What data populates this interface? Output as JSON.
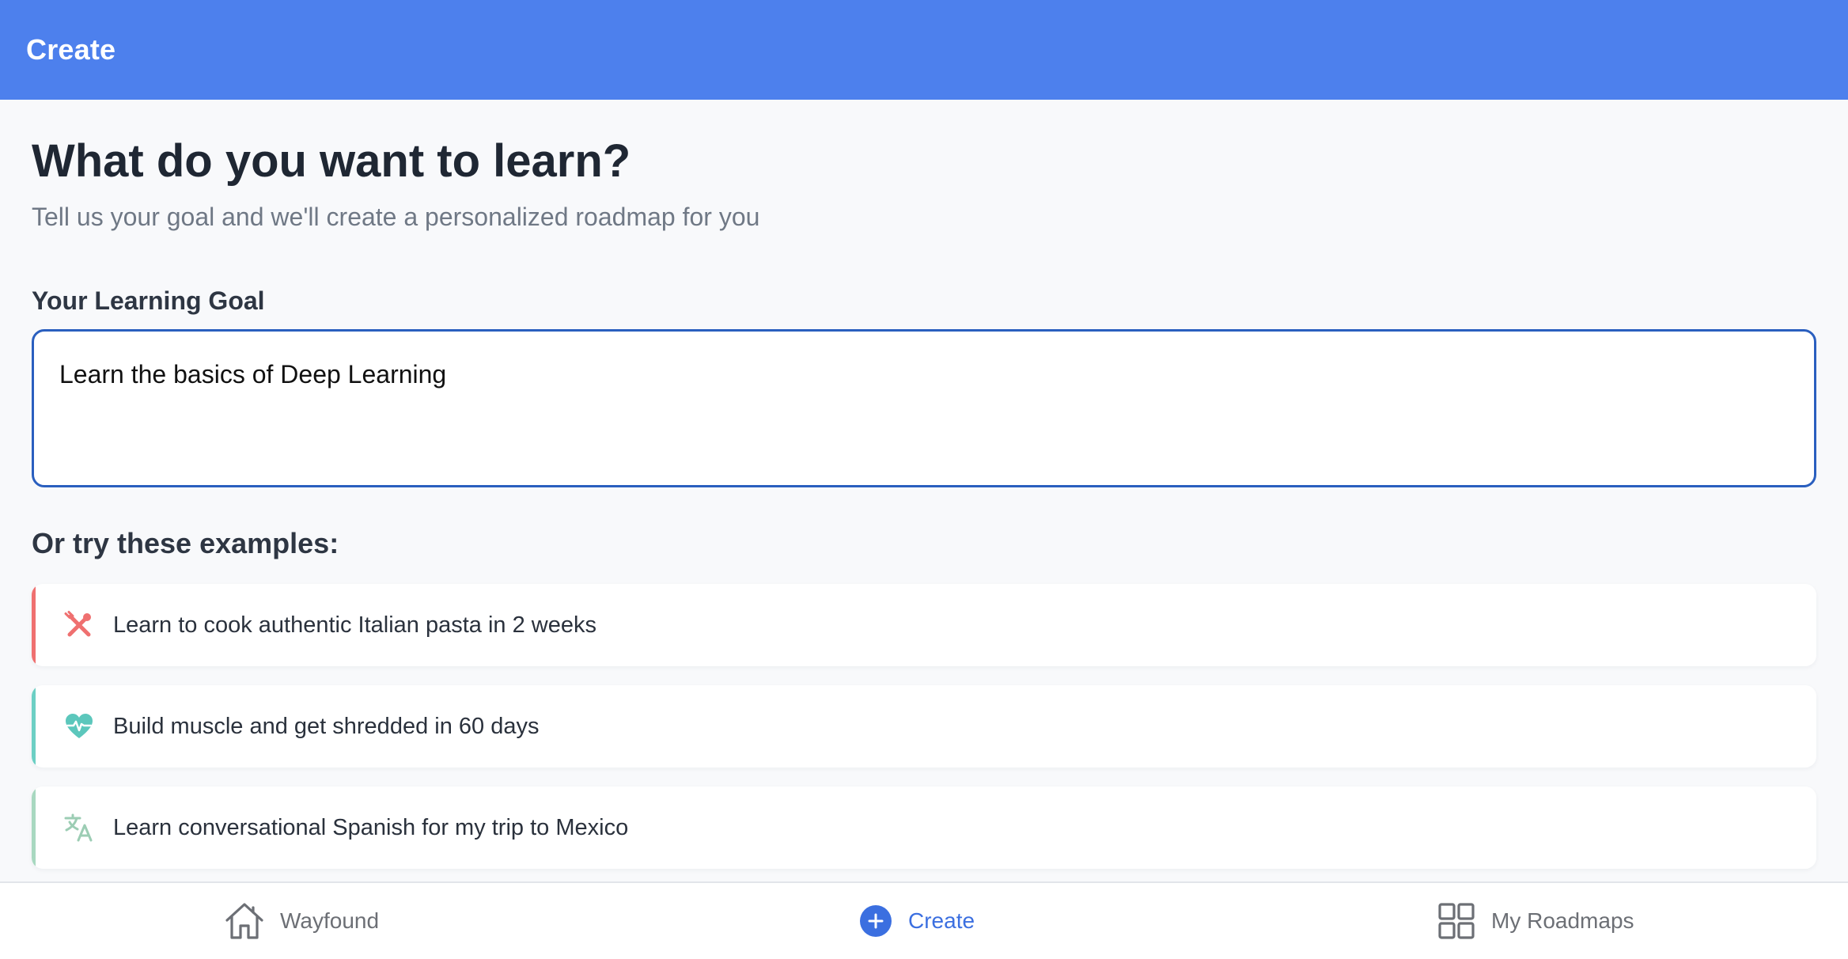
{
  "header": {
    "title": "Create",
    "background_color": "#4d80ed"
  },
  "main": {
    "title": "What do you want to learn?",
    "subtitle": "Tell us your goal and we'll create a personalized roadmap for you",
    "goal_label": "Your Learning Goal",
    "goal_value": "Learn the basics of Deep Learning",
    "examples_heading": "Or try these examples:",
    "examples": [
      {
        "text": "Learn to cook authentic Italian pasta in 2 weeks",
        "icon": "fork-knife-icon",
        "accent_color": "#ef7070"
      },
      {
        "text": "Build muscle and get shredded in 60 days",
        "icon": "heart-pulse-icon",
        "accent_color": "#6ccfc4"
      },
      {
        "text": "Learn conversational Spanish for my trip to Mexico",
        "icon": "translate-icon",
        "accent_color": "#a8d8c0"
      }
    ]
  },
  "tab_bar": {
    "active_color": "#3b6fe0",
    "tabs": [
      {
        "label": "Wayfound",
        "icon": "home-icon",
        "active": false
      },
      {
        "label": "Create",
        "icon": "plus-circle-icon",
        "active": true
      },
      {
        "label": "My Roadmaps",
        "icon": "grid-icon",
        "active": false
      }
    ]
  }
}
